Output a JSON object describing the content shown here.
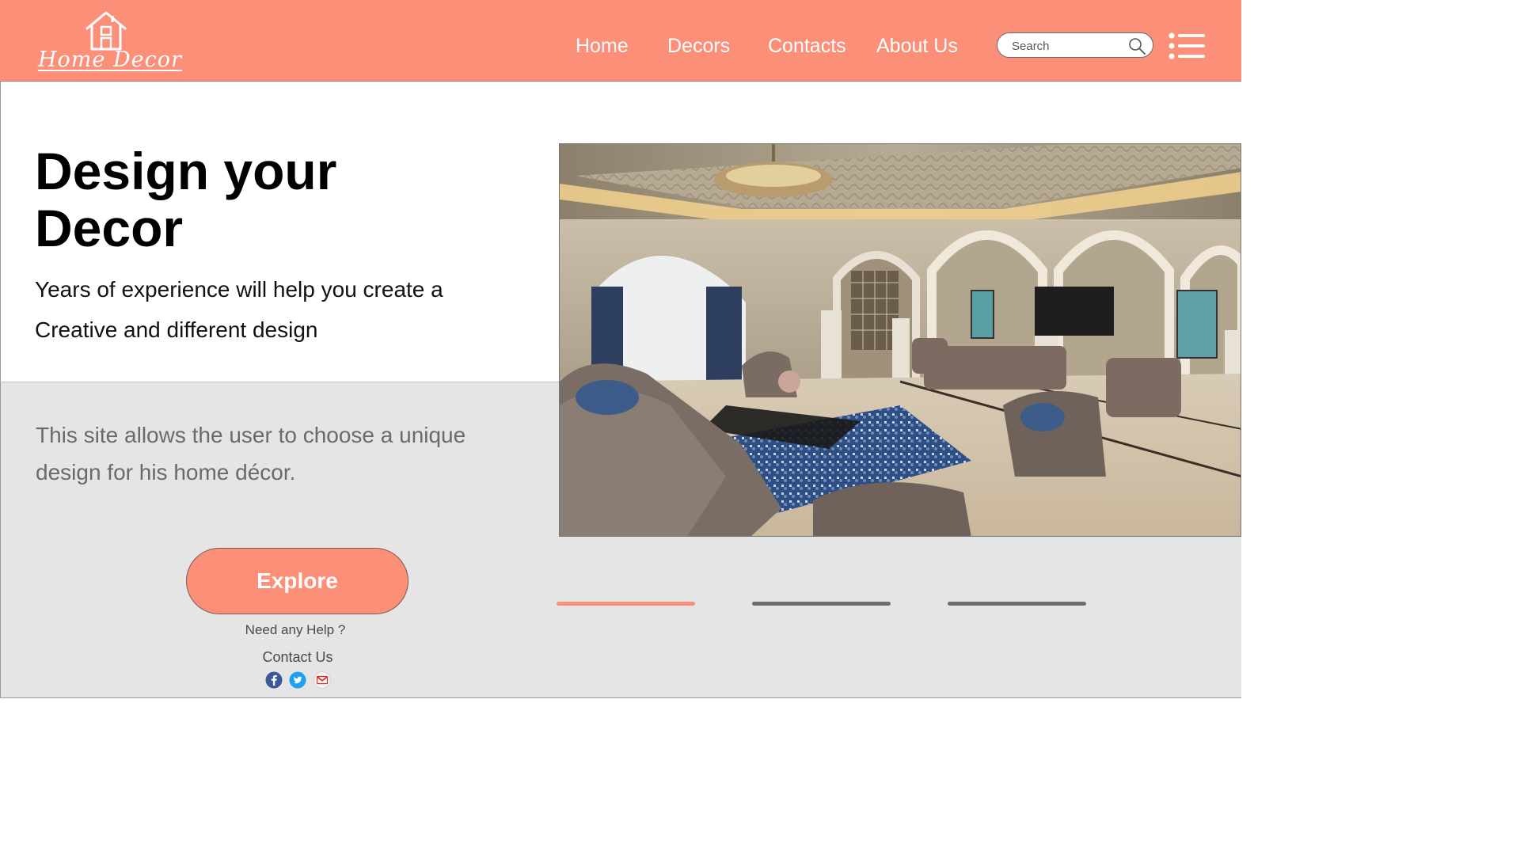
{
  "header": {
    "logo_text": "Home Decor",
    "nav": [
      "Home",
      "Decors",
      "Contacts",
      "About Us"
    ],
    "search_placeholder": "Search"
  },
  "hero": {
    "title_line1": "Design your",
    "title_line2": "Decor",
    "subtitle_line1": "Years of experience will help you create a",
    "subtitle_line2": "Creative and different design",
    "description_line1": "This site allows the user to choose a unique",
    "description_line2": "design for his home décor."
  },
  "cta": {
    "explore_label": "Explore",
    "help_text": "Need any Help ?",
    "contact_label": "Contact Us"
  },
  "social": [
    "facebook-icon",
    "twitter-icon",
    "gmail-icon"
  ],
  "slider": {
    "total": 3,
    "active": 1
  },
  "colors": {
    "accent": "#fc8f78",
    "panel_gray": "#e6e5e6",
    "inactive_indicator": "#6e6e6e",
    "facebook": "#3b5998",
    "twitter": "#1da1f2",
    "gmail_red": "#d93025"
  }
}
